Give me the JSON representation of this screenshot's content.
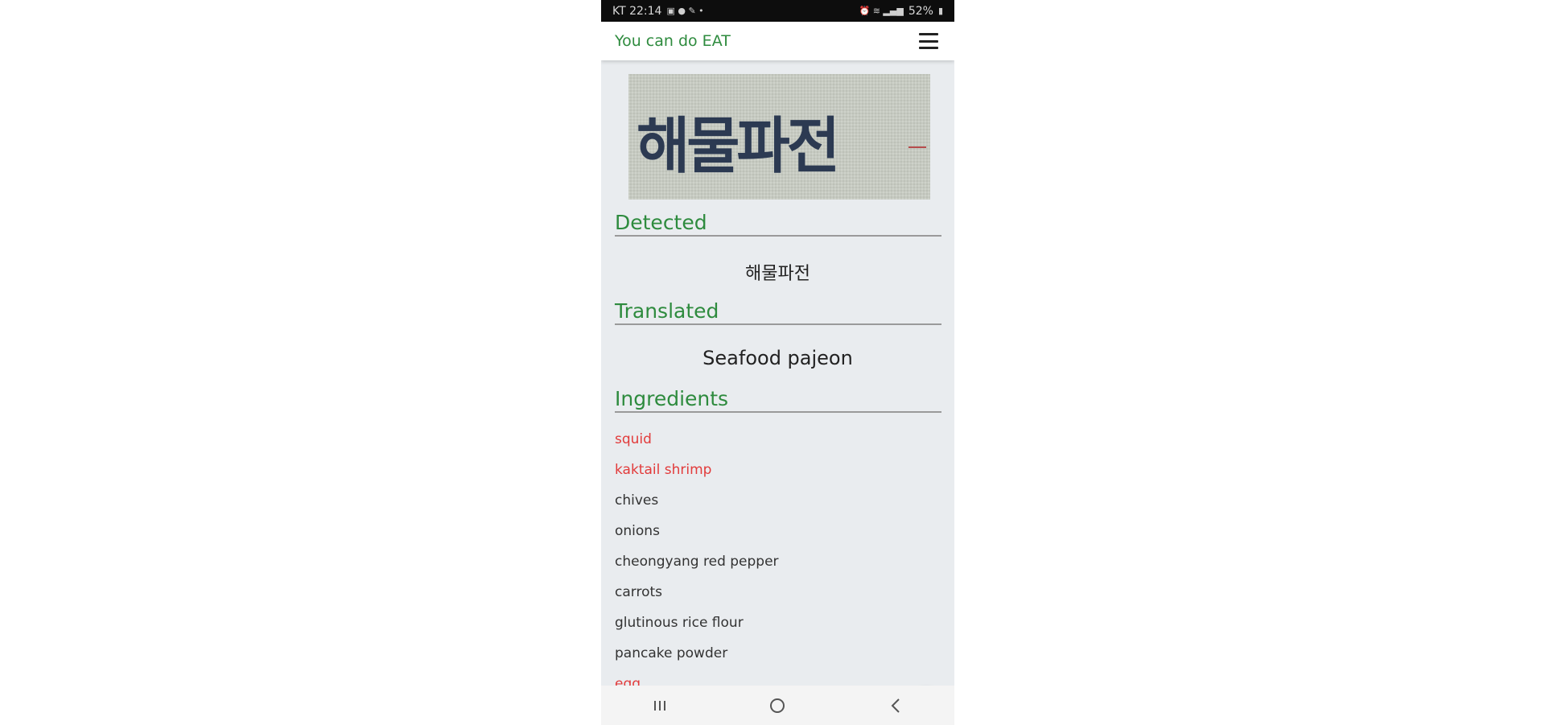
{
  "status_bar": {
    "carrier_time": "KT 22:14",
    "battery": "52%"
  },
  "app_bar": {
    "title": "You can do EAT",
    "menu_icon": "hamburger-menu-icon"
  },
  "sign_photo": {
    "text": "해물파전"
  },
  "detected": {
    "heading": "Detected",
    "value": "해물파전"
  },
  "translated": {
    "heading": "Translated",
    "value": "Seafood pajeon"
  },
  "ingredients": {
    "heading": "Ingredients",
    "items": [
      {
        "name": "squid",
        "alert": true
      },
      {
        "name": "kaktail shrimp",
        "alert": true
      },
      {
        "name": "chives",
        "alert": false
      },
      {
        "name": "onions",
        "alert": false
      },
      {
        "name": "cheongyang red pepper",
        "alert": false
      },
      {
        "name": "carrots",
        "alert": false
      },
      {
        "name": "glutinous rice flour",
        "alert": false
      },
      {
        "name": "pancake powder",
        "alert": false
      },
      {
        "name": "egg",
        "alert": true
      }
    ]
  },
  "fab": {
    "icon": "translate-icon"
  },
  "nav_bar": {
    "recent_icon": "recent-apps-icon",
    "home_icon": "home-icon",
    "back_icon": "back-icon"
  },
  "colors": {
    "accent": "#2e8b3e",
    "alert": "#e23b3b",
    "background": "#e9ecef"
  }
}
